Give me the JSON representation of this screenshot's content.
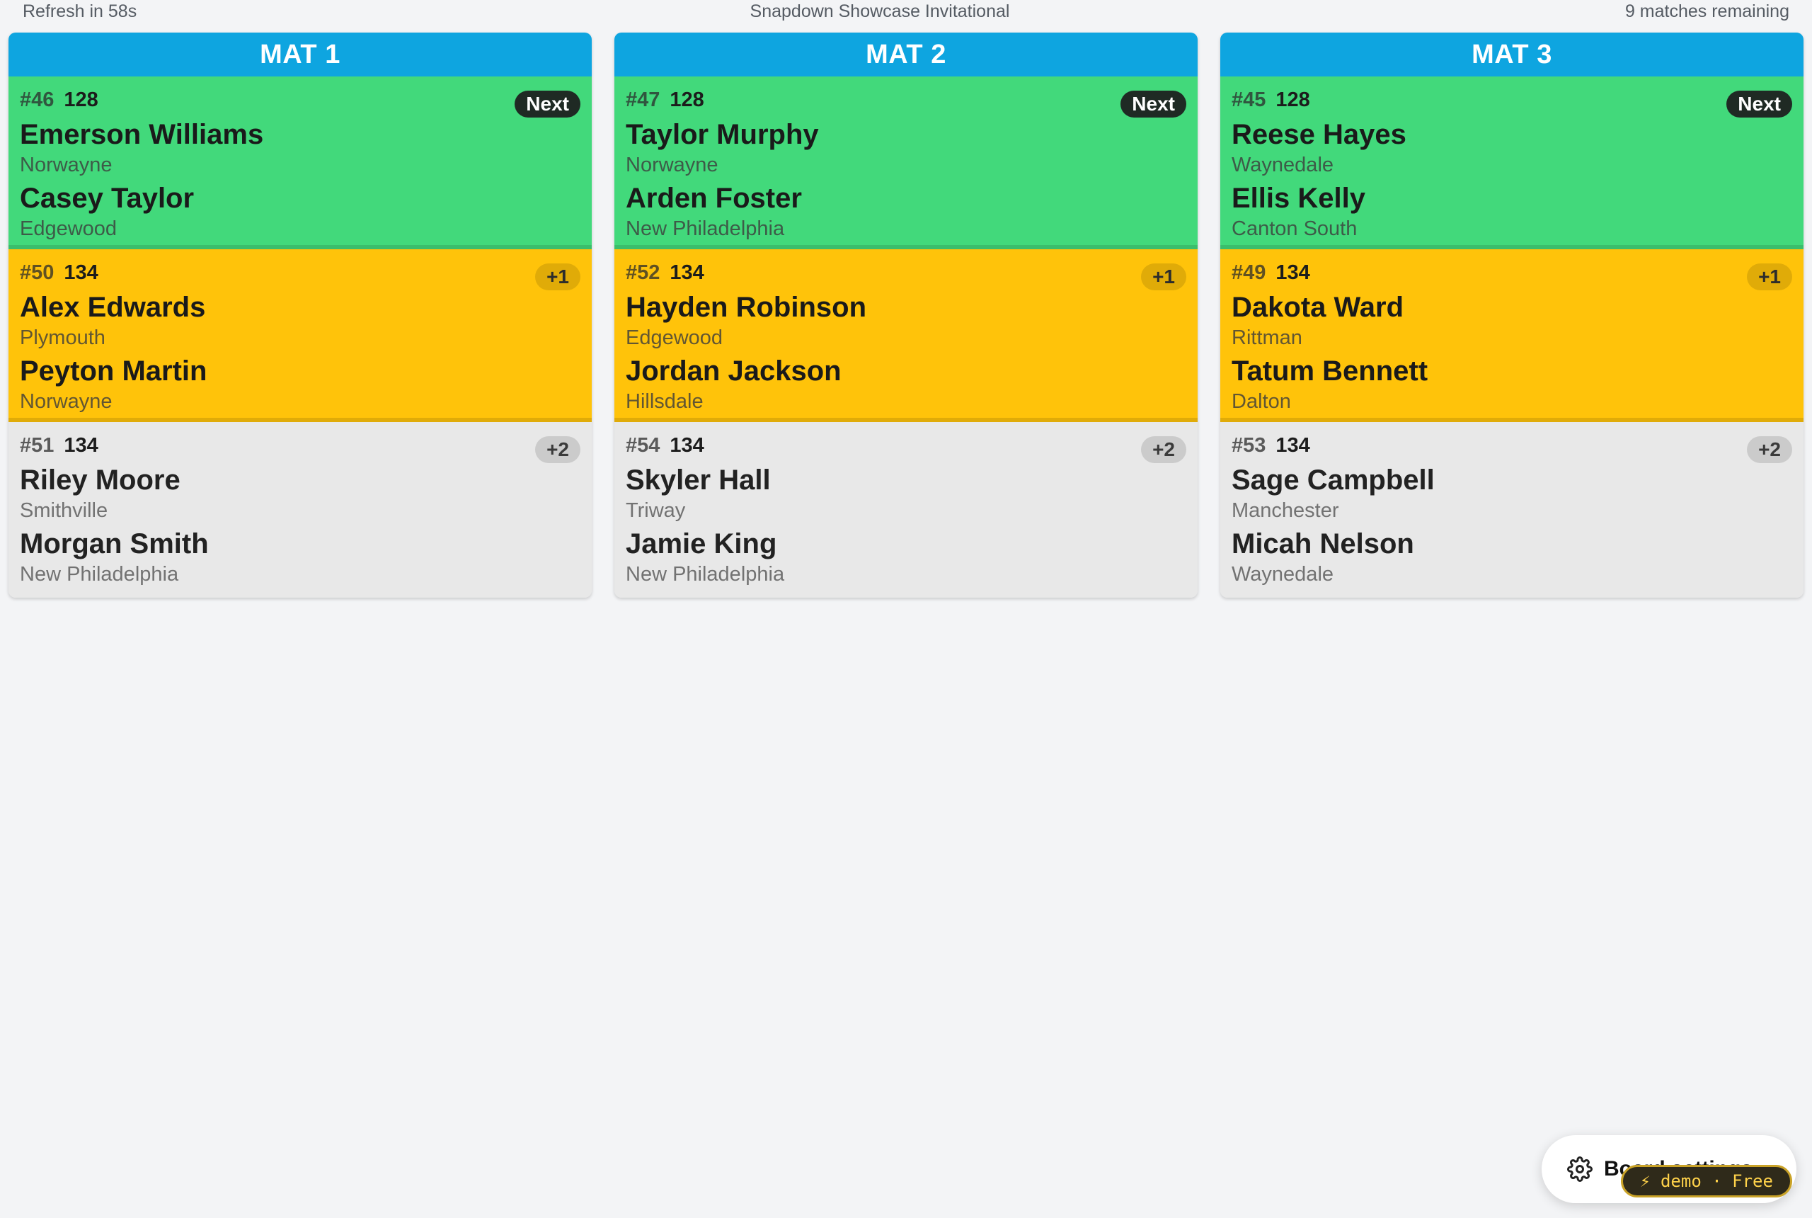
{
  "topbar": {
    "refresh": "Refresh in 58s",
    "event": "Snapdown Showcase Invitational",
    "remaining": "9 matches remaining"
  },
  "colors": {
    "mat_header": "#0ea5e0",
    "next": "#42d97b",
    "on_deck": "#ffc30a",
    "later": "#e8e8e8"
  },
  "mats": [
    {
      "title": "MAT 1",
      "matches": [
        {
          "num": "#46",
          "weight": "128",
          "badge": "Next",
          "w1": "Emerson Williams",
          "t1": "Norwayne",
          "w2": "Casey Taylor",
          "t2": "Edgewood"
        },
        {
          "num": "#50",
          "weight": "134",
          "badge": "+1",
          "w1": "Alex Edwards",
          "t1": "Plymouth",
          "w2": "Peyton Martin",
          "t2": "Norwayne"
        },
        {
          "num": "#51",
          "weight": "134",
          "badge": "+2",
          "w1": "Riley Moore",
          "t1": "Smithville",
          "w2": "Morgan Smith",
          "t2": "New Philadelphia"
        }
      ]
    },
    {
      "title": "MAT 2",
      "matches": [
        {
          "num": "#47",
          "weight": "128",
          "badge": "Next",
          "w1": "Taylor Murphy",
          "t1": "Norwayne",
          "w2": "Arden Foster",
          "t2": "New Philadelphia"
        },
        {
          "num": "#52",
          "weight": "134",
          "badge": "+1",
          "w1": "Hayden Robinson",
          "t1": "Edgewood",
          "w2": "Jordan Jackson",
          "t2": "Hillsdale"
        },
        {
          "num": "#54",
          "weight": "134",
          "badge": "+2",
          "w1": "Skyler Hall",
          "t1": "Triway",
          "w2": "Jamie King",
          "t2": "New Philadelphia"
        }
      ]
    },
    {
      "title": "MAT 3",
      "matches": [
        {
          "num": "#45",
          "weight": "128",
          "badge": "Next",
          "w1": "Reese Hayes",
          "t1": "Waynedale",
          "w2": "Ellis Kelly",
          "t2": "Canton South"
        },
        {
          "num": "#49",
          "weight": "134",
          "badge": "+1",
          "w1": "Dakota Ward",
          "t1": "Rittman",
          "w2": "Tatum Bennett",
          "t2": "Dalton"
        },
        {
          "num": "#53",
          "weight": "134",
          "badge": "+2",
          "w1": "Sage Campbell",
          "t1": "Manchester",
          "w2": "Micah Nelson",
          "t2": "Waynedale"
        }
      ]
    }
  ],
  "settings": {
    "label": "Board settings",
    "icon": "gear-icon"
  },
  "demo_badge": {
    "text": "⚡ demo · Free"
  }
}
